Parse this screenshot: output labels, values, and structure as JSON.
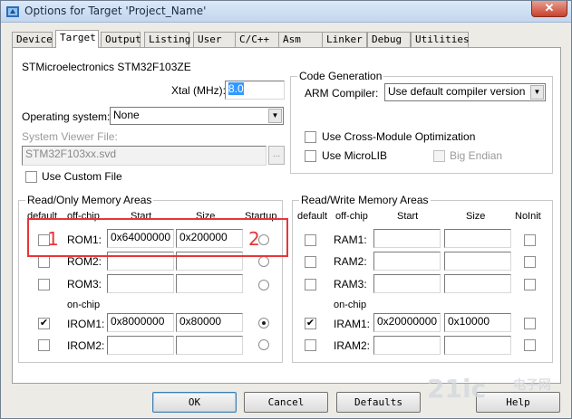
{
  "window": {
    "title": "Options for Target 'Project_Name'",
    "close_label": "✕"
  },
  "tabs": [
    {
      "label": "Device"
    },
    {
      "label": "Target"
    },
    {
      "label": "Output"
    },
    {
      "label": "Listing"
    },
    {
      "label": "User"
    },
    {
      "label": "C/C++"
    },
    {
      "label": "Asm"
    },
    {
      "label": "Linker"
    },
    {
      "label": "Debug"
    },
    {
      "label": "Utilities"
    }
  ],
  "target": {
    "device_name": "STMicroelectronics STM32F103ZE",
    "xtal_label": "Xtal (MHz):",
    "xtal_value": "8.0",
    "os_label": "Operating system:",
    "os_value": "None",
    "svd_label": "System Viewer File:",
    "svd_value": "STM32F103xx.svd",
    "browse_label": "...",
    "custom_file_label": "Use Custom File"
  },
  "codegen": {
    "title": "Code Generation",
    "compiler_label": "ARM Compiler:",
    "compiler_value": "Use default compiler version",
    "cross_module_label": "Use Cross-Module Optimization",
    "microlib_label": "Use MicroLIB",
    "big_endian_label": "Big Endian"
  },
  "rom_area": {
    "title": "Read/Only Memory Areas",
    "headers": {
      "default": "default",
      "offchip": "off-chip",
      "start": "Start",
      "size": "Size",
      "startup": "Startup"
    },
    "onchip_label": "on-chip",
    "rows": [
      {
        "name": "ROM1:",
        "start": "0x64000000",
        "size": "0x200000",
        "default": false,
        "startup": false
      },
      {
        "name": "ROM2:",
        "start": "",
        "size": "",
        "default": false,
        "startup": false
      },
      {
        "name": "ROM3:",
        "start": "",
        "size": "",
        "default": false,
        "startup": false
      },
      {
        "name": "IROM1:",
        "start": "0x8000000",
        "size": "0x80000",
        "default": true,
        "startup": true
      },
      {
        "name": "IROM2:",
        "start": "",
        "size": "",
        "default": false,
        "startup": false
      }
    ]
  },
  "ram_area": {
    "title": "Read/Write Memory Areas",
    "headers": {
      "default": "default",
      "offchip": "off-chip",
      "start": "Start",
      "size": "Size",
      "noinit": "NoInit"
    },
    "onchip_label": "on-chip",
    "rows": [
      {
        "name": "RAM1:",
        "start": "",
        "size": "",
        "default": false
      },
      {
        "name": "RAM2:",
        "start": "",
        "size": "",
        "default": false
      },
      {
        "name": "RAM3:",
        "start": "",
        "size": "",
        "default": false
      },
      {
        "name": "IRAM1:",
        "start": "0x20000000",
        "size": "0x10000",
        "default": true
      },
      {
        "name": "IRAM2:",
        "start": "",
        "size": "",
        "default": false
      }
    ]
  },
  "annotations": {
    "marker1": "1",
    "marker2": "2",
    "color": "#e8353a"
  },
  "buttons": {
    "ok": "OK",
    "cancel": "Cancel",
    "defaults": "Defaults",
    "help": "Help"
  },
  "watermark": {
    "main": "21ic",
    "sub": "电子网"
  }
}
